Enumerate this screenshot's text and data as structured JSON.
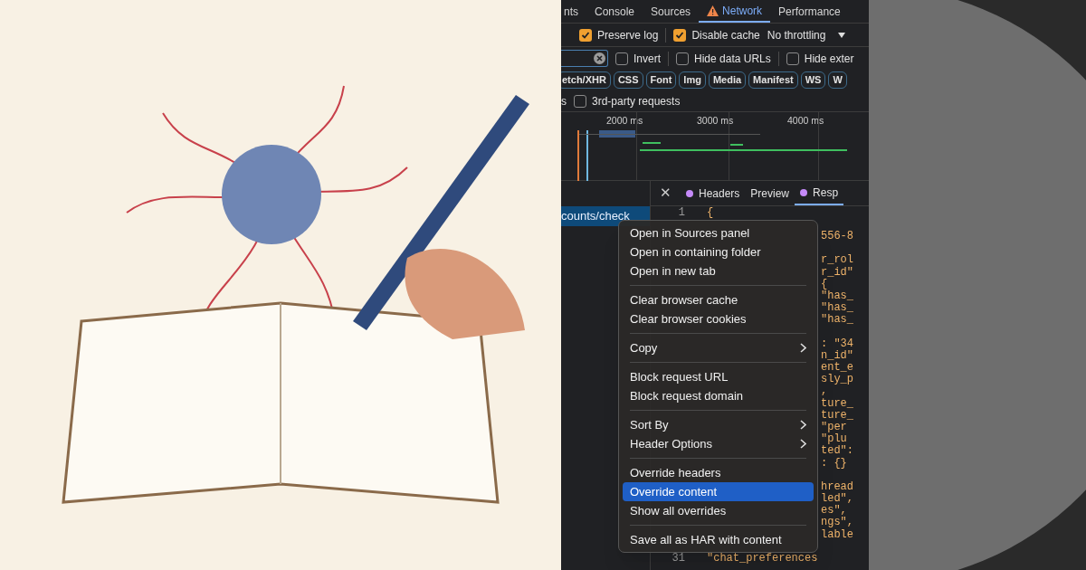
{
  "devtools": {
    "tabs": [
      {
        "label": "nts",
        "selected": false,
        "warning": false
      },
      {
        "label": "Console",
        "selected": false,
        "warning": false
      },
      {
        "label": "Sources",
        "selected": false,
        "warning": false
      },
      {
        "label": "Network",
        "selected": true,
        "warning": true
      },
      {
        "label": "Performance",
        "selected": false,
        "warning": false
      }
    ],
    "toolbar": {
      "preserve_log": {
        "label": "Preserve log",
        "checked": true
      },
      "disable_cache": {
        "label": "Disable cache",
        "checked": true
      },
      "throttling": "No throttling"
    },
    "filter_row": [
      {
        "label": "Invert",
        "checked": false
      },
      {
        "label": "Hide data URLs",
        "checked": false
      },
      {
        "label": "Hide exter",
        "checked": false
      }
    ],
    "type_filters": [
      "etch/XHR",
      "CSS",
      "Font",
      "Img",
      "Media",
      "Manifest",
      "WS",
      "W"
    ],
    "third_party": {
      "prefix": "s",
      "label": "3rd-party requests",
      "checked": false
    },
    "timeline_ticks": [
      "2000 ms",
      "3000 ms",
      "4000 ms"
    ],
    "request_row": {
      "label": "counts/check",
      "selected": true
    },
    "detail_close": "✕",
    "detail_tabs": [
      {
        "label": "Headers",
        "dot": true,
        "selected": false
      },
      {
        "label": "Preview",
        "dot": false,
        "selected": false
      },
      {
        "label": "Resp",
        "dot": true,
        "selected": true
      }
    ],
    "code_lines": [
      {
        "number": "1",
        "text": "{"
      },
      {
        "text": "556-8",
        "gap_before": true
      },
      {
        "text": "r_rol",
        "gap_before": true
      },
      {
        "text": "r_id\""
      },
      {
        "text": " {"
      },
      {
        "text": "\"has_"
      },
      {
        "text": "\"has_"
      },
      {
        "text": "\"has_"
      },
      {
        "text": ": \"34",
        "gap_before": true
      },
      {
        "text": "n_id\""
      },
      {
        "text": "ent_e"
      },
      {
        "text": "sly_p"
      },
      {
        "text": ","
      },
      {
        "text": "ture_"
      },
      {
        "text": "ture_"
      },
      {
        "text": " \"per"
      },
      {
        "text": " \"plu"
      },
      {
        "text": "ted\":"
      },
      {
        "text": ": {}"
      },
      {
        "text": "hread",
        "gap_before": true
      },
      {
        "text": "led\","
      },
      {
        "text": "es\","
      },
      {
        "text": "ngs\","
      },
      {
        "text": "lable"
      },
      {
        "number": "31",
        "text": "\"chat_preferences",
        "gap_before": true
      }
    ],
    "context_menu": [
      {
        "kind": "item",
        "label": "Open in Sources panel",
        "submenu": false,
        "selected": false
      },
      {
        "kind": "item",
        "label": "Open in containing folder",
        "submenu": false,
        "selected": false
      },
      {
        "kind": "item",
        "label": "Open in new tab",
        "submenu": false,
        "selected": false
      },
      {
        "kind": "separator"
      },
      {
        "kind": "item",
        "label": "Clear browser cache",
        "submenu": false,
        "selected": false
      },
      {
        "kind": "item",
        "label": "Clear browser cookies",
        "submenu": false,
        "selected": false
      },
      {
        "kind": "separator"
      },
      {
        "kind": "item",
        "label": "Copy",
        "submenu": true,
        "selected": false
      },
      {
        "kind": "separator"
      },
      {
        "kind": "item",
        "label": "Block request URL",
        "submenu": false,
        "selected": false
      },
      {
        "kind": "item",
        "label": "Block request domain",
        "submenu": false,
        "selected": false
      },
      {
        "kind": "separator"
      },
      {
        "kind": "item",
        "label": "Sort By",
        "submenu": true,
        "selected": false
      },
      {
        "kind": "item",
        "label": "Header Options",
        "submenu": true,
        "selected": false
      },
      {
        "kind": "separator"
      },
      {
        "kind": "item",
        "label": "Override headers",
        "submenu": false,
        "selected": false
      },
      {
        "kind": "item",
        "label": "Override content",
        "submenu": false,
        "selected": true
      },
      {
        "kind": "item",
        "label": "Show all overrides",
        "submenu": false,
        "selected": false
      },
      {
        "kind": "separator"
      },
      {
        "kind": "item",
        "label": "Save all as HAR with content",
        "submenu": false,
        "selected": false
      }
    ]
  }
}
